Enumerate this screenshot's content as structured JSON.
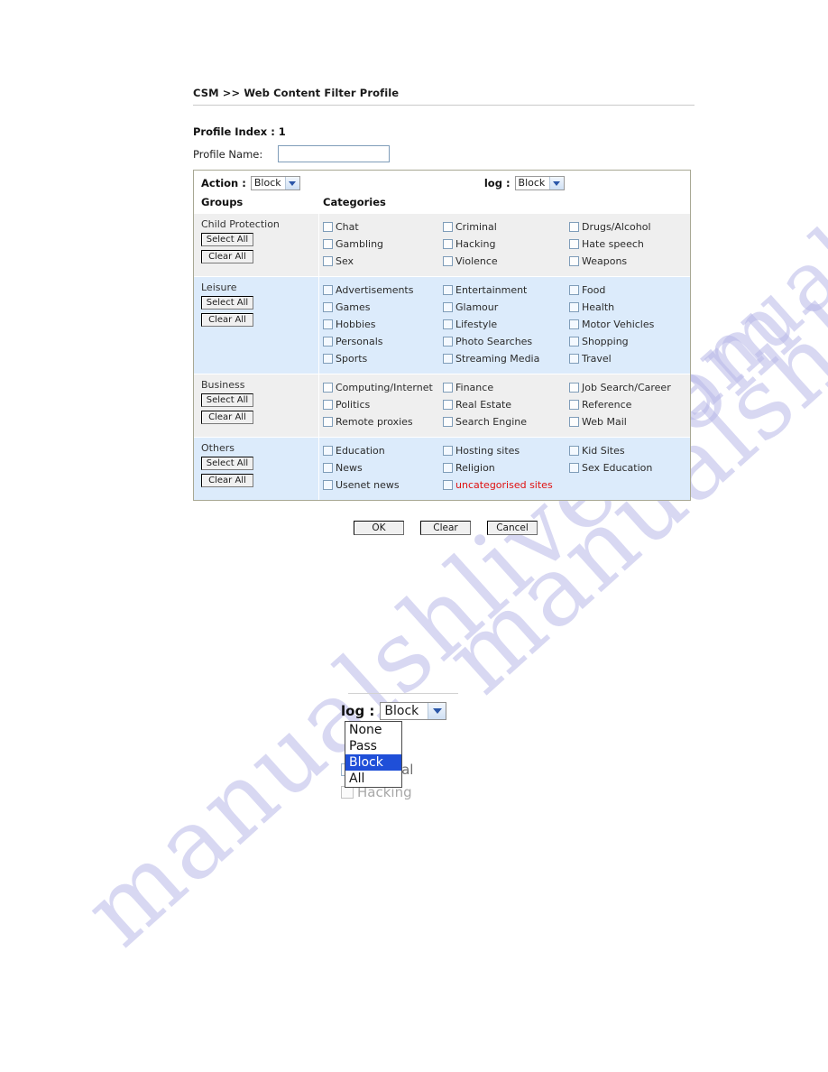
{
  "breadcrumb": "CSM >> Web Content Filter Profile",
  "profile": {
    "index_label": "Profile Index : 1",
    "name_label": "Profile Name:",
    "name_value": "",
    "name_placeholder": ""
  },
  "toolbar": {
    "action_label": "Action :",
    "action_value": "Block",
    "log_label": "log :",
    "log_value": "Block"
  },
  "table": {
    "groups_header": "Groups",
    "categories_header": "Categories",
    "select_all_label": "Select All",
    "clear_all_label": "Clear All",
    "rows": [
      {
        "group": "Child Protection",
        "shade": "gray",
        "columns": [
          [
            {
              "label": "Chat",
              "red": false
            },
            {
              "label": "Gambling",
              "red": false
            },
            {
              "label": "Sex",
              "red": false
            }
          ],
          [
            {
              "label": "Criminal",
              "red": false
            },
            {
              "label": "Hacking",
              "red": false
            },
            {
              "label": "Violence",
              "red": false
            }
          ],
          [
            {
              "label": "Drugs/Alcohol",
              "red": false
            },
            {
              "label": "Hate speech",
              "red": false
            },
            {
              "label": "Weapons",
              "red": false
            }
          ]
        ]
      },
      {
        "group": "Leisure",
        "shade": "blue",
        "columns": [
          [
            {
              "label": "Advertisements",
              "red": false
            },
            {
              "label": "Games",
              "red": false
            },
            {
              "label": "Hobbies",
              "red": false
            },
            {
              "label": "Personals",
              "red": false
            },
            {
              "label": "Sports",
              "red": false
            }
          ],
          [
            {
              "label": "Entertainment",
              "red": false
            },
            {
              "label": "Glamour",
              "red": false
            },
            {
              "label": "Lifestyle",
              "red": false
            },
            {
              "label": "Photo Searches",
              "red": false
            },
            {
              "label": "Streaming Media",
              "red": false
            }
          ],
          [
            {
              "label": "Food",
              "red": false
            },
            {
              "label": "Health",
              "red": false
            },
            {
              "label": "Motor Vehicles",
              "red": false
            },
            {
              "label": "Shopping",
              "red": false
            },
            {
              "label": "Travel",
              "red": false
            }
          ]
        ]
      },
      {
        "group": "Business",
        "shade": "gray",
        "columns": [
          [
            {
              "label": "Computing/Internet",
              "red": false
            },
            {
              "label": "Politics",
              "red": false
            },
            {
              "label": "Remote proxies",
              "red": false
            }
          ],
          [
            {
              "label": "Finance",
              "red": false
            },
            {
              "label": "Real Estate",
              "red": false
            },
            {
              "label": "Search Engine",
              "red": false
            }
          ],
          [
            {
              "label": "Job Search/Career",
              "red": false
            },
            {
              "label": "Reference",
              "red": false
            },
            {
              "label": "Web Mail",
              "red": false
            }
          ]
        ]
      },
      {
        "group": "Others",
        "shade": "blue",
        "columns": [
          [
            {
              "label": "Education",
              "red": false
            },
            {
              "label": "News",
              "red": false
            },
            {
              "label": "Usenet news",
              "red": false
            }
          ],
          [
            {
              "label": "Hosting sites",
              "red": false
            },
            {
              "label": "Religion",
              "red": false
            },
            {
              "label": "uncategorised sites",
              "red": true
            }
          ],
          [
            {
              "label": "Kid Sites",
              "red": false
            },
            {
              "label": "Sex Education",
              "red": false
            }
          ]
        ]
      }
    ]
  },
  "footer": {
    "ok_label": "OK",
    "clear_label": "Clear",
    "cancel_label": "Cancel"
  },
  "detail": {
    "log_label": "log :",
    "log_value": "Block",
    "options": [
      {
        "label": "None",
        "selected": false
      },
      {
        "label": "Pass",
        "selected": false
      },
      {
        "label": "Block",
        "selected": true
      },
      {
        "label": "All",
        "selected": false
      }
    ],
    "ghost_items": [
      {
        "label": "Criminal",
        "dim": false
      },
      {
        "label": "Hacking",
        "dim": true
      }
    ]
  },
  "watermark": {
    "line": "manualshlive.com"
  },
  "colors": {
    "row_gray": "#efefef",
    "row_blue": "#dcebfb",
    "red_text": "#e01010",
    "highlight": "#1f4fd8",
    "panel_border": "#a8a894",
    "input_border": "#7f9db9"
  }
}
